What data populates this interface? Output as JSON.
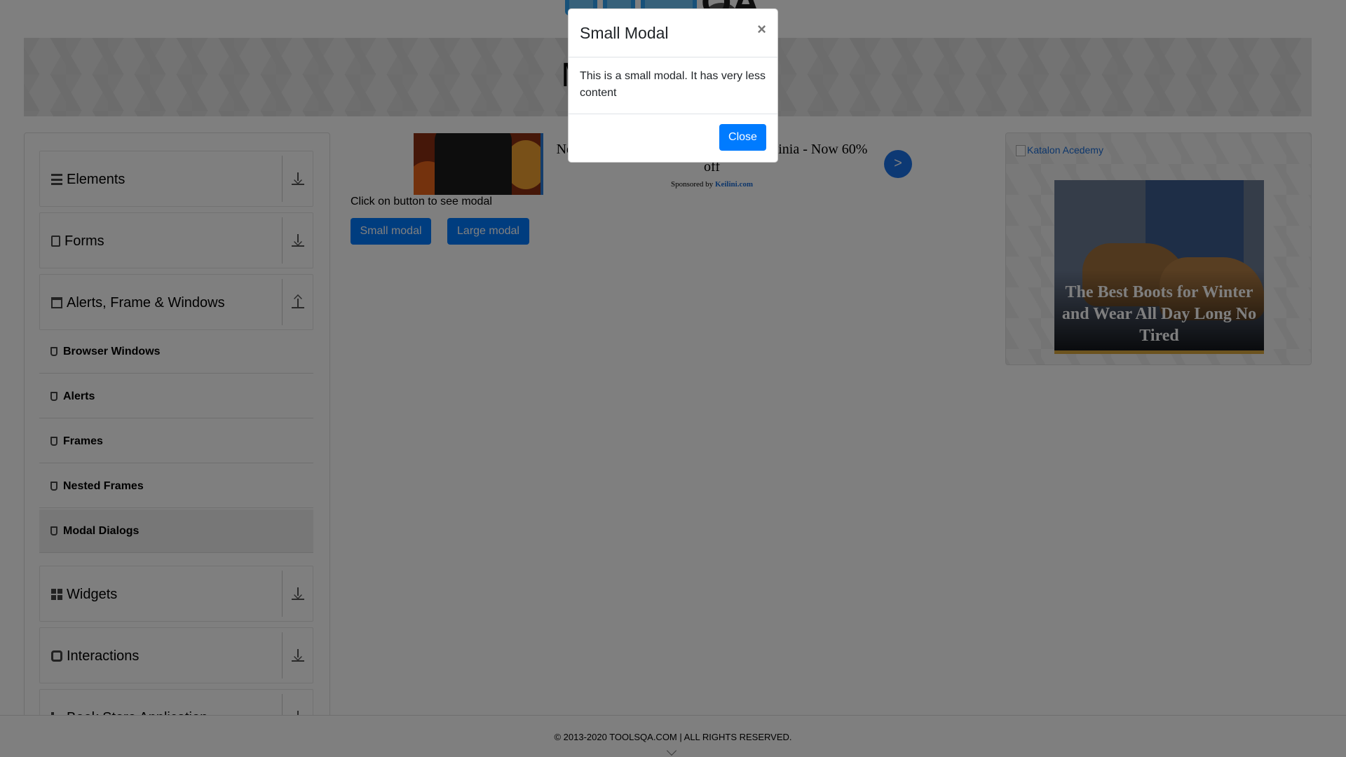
{
  "header": {
    "logo_alt": "TOOLSQA"
  },
  "banner": {
    "title": "Modal Dialogs"
  },
  "sidebar": {
    "groups": [
      {
        "label": "Elements",
        "icon": "bars-icon"
      },
      {
        "label": "Forms",
        "icon": "document-icon"
      },
      {
        "label": "Alerts, Frame & Windows",
        "icon": "window-icon"
      },
      {
        "label": "Widgets",
        "icon": "grid-icon"
      },
      {
        "label": "Interactions",
        "icon": "sync-icon"
      },
      {
        "label": "Book Store Application",
        "icon": "book-icon"
      }
    ],
    "sub_items": [
      {
        "label": "Browser Windows"
      },
      {
        "label": "Alerts"
      },
      {
        "label": "Frames"
      },
      {
        "label": "Nested Frames"
      },
      {
        "label": "Modal Dialogs"
      }
    ]
  },
  "ad_top": {
    "title": "New Heated Vest is Going Viral in Virginia - Now 60% off",
    "sponsor_prefix": "Sponsored by",
    "sponsor": "Keilini.com",
    "next": ">"
  },
  "main": {
    "hint": "Click on button to see modal",
    "small_button": "Small modal",
    "large_button": "Large modal"
  },
  "right_ad": {
    "alt_text": "Katalon Acedemy",
    "caption": "The Best Boots for Winter and Wear All Day Long No Tired"
  },
  "footer": {
    "copyright": "© 2013-2020 TOOLSQA.COM | ALL RIGHTS RESERVED."
  },
  "modal": {
    "title": "Small Modal",
    "close_x": "×",
    "body": "This is a small modal. It has very less content",
    "close_button": "Close"
  },
  "colors": {
    "primary": "#007bff",
    "overlay": "rgba(0,0,0,0.5)"
  }
}
